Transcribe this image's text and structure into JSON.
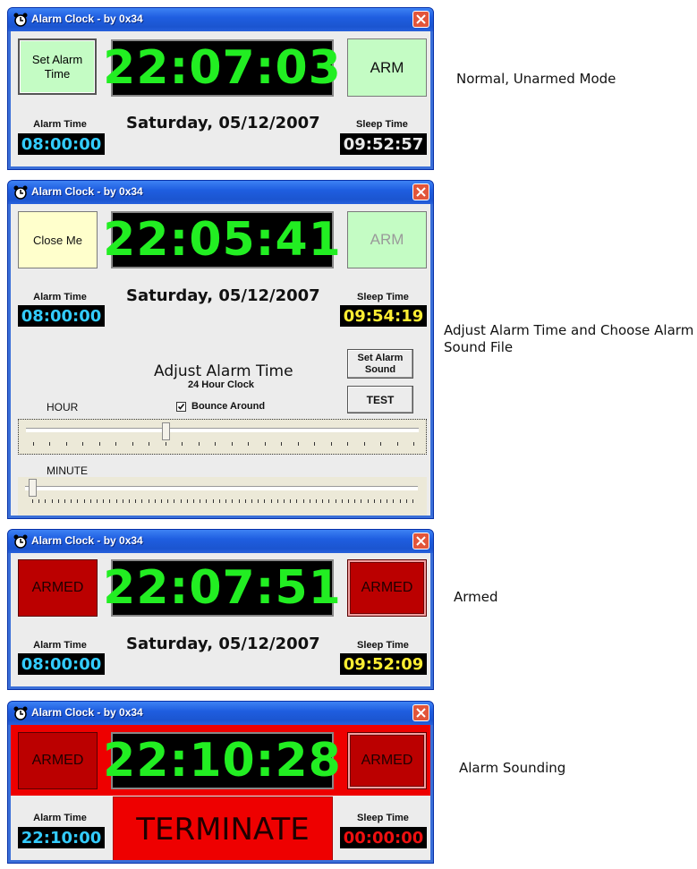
{
  "window_title": "Alarm Clock - by 0x34",
  "date": "Saturday, 05/12/2007",
  "alarm_time_label": "Alarm Time",
  "sleep_time_label": "Sleep Time",
  "panel1": {
    "left_button": "Set Alarm Time",
    "clock": "22:07:03",
    "arm_button": "ARM",
    "alarm_time": "08:00:00",
    "sleep_time": "09:52:57",
    "caption": "Normal, Unarmed Mode"
  },
  "panel2": {
    "left_button": "Close Me",
    "clock": "22:05:41",
    "arm_button": "ARM",
    "alarm_time": "08:00:00",
    "sleep_time": "09:54:19",
    "adjust_title": "Adjust Alarm Time",
    "adjust_subtitle": "24 Hour Clock",
    "set_sound_button": "Set Alarm Sound",
    "test_button": "TEST",
    "hour_label": "HOUR",
    "bounce_label": "Bounce Around",
    "bounce_checked": true,
    "minute_label": "MINUTE",
    "hour_slider_value": 8,
    "hour_slider_max": 23,
    "minute_slider_value": 0,
    "minute_slider_max": 59,
    "caption": "Adjust Alarm Time and Choose Alarm Sound File"
  },
  "panel3": {
    "left_button": "ARMED",
    "clock": "22:07:51",
    "arm_button": "ARMED",
    "alarm_time": "08:00:00",
    "sleep_time": "09:52:09",
    "caption": "Armed"
  },
  "panel4": {
    "left_button": "ARMED",
    "clock": "22:10:28",
    "arm_button": "ARMED",
    "terminate_button": "TERMINATE",
    "alarm_time": "22:10:00",
    "sleep_time": "00:00:00",
    "caption": "Alarm Sounding"
  },
  "captions_split": {
    "panel2_line1": "Adjust Alarm Time and Choose Alarm",
    "panel2_line2": "Sound File"
  },
  "colors": {
    "clock_green": "#22ee22",
    "alarm_cyan": "#33ccff",
    "armed_red": "#bb0000",
    "alarm_background": "#ee0000"
  },
  "icons": [
    "alarm-clock-icon",
    "close-icon",
    "checkmark-icon"
  ]
}
